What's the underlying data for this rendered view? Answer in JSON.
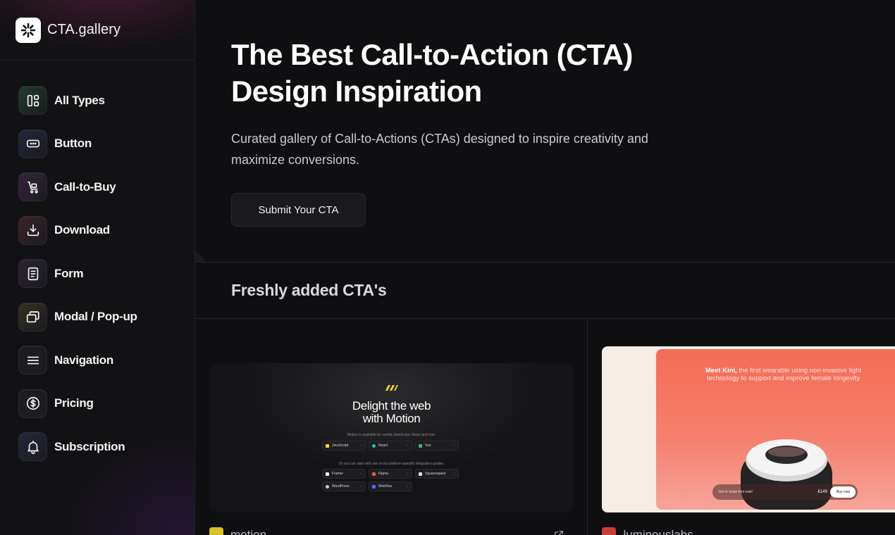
{
  "brand": {
    "name": "CTA.gallery",
    "logo_icon": "sparkle-icon"
  },
  "sidebar": {
    "items": [
      {
        "label": "All Types",
        "icon": "grid-layout-icon",
        "accent": "#2f4a3a"
      },
      {
        "label": "Button",
        "icon": "button-icon",
        "accent": "#262a3a"
      },
      {
        "label": "Call-to-Buy",
        "icon": "cart-icon",
        "accent": "#3a2a3a"
      },
      {
        "label": "Download",
        "icon": "download-icon",
        "accent": "#3a2a2e"
      },
      {
        "label": "Form",
        "icon": "form-icon",
        "accent": "#2a2630"
      },
      {
        "label": "Modal / Pop-up",
        "icon": "modal-icon",
        "accent": "#33302a"
      },
      {
        "label": "Navigation",
        "icon": "menu-icon",
        "accent": "#26262b"
      },
      {
        "label": "Pricing",
        "icon": "dollar-icon",
        "accent": "#26262b"
      },
      {
        "label": "Subscription",
        "icon": "bell-icon",
        "accent": "#262a36"
      }
    ]
  },
  "hero": {
    "title": "The Best Call-to-Action (CTA) Design Inspiration",
    "subtitle": "Curated gallery of Call-to-Actions (CTAs) designed to inspire creativity and maximize conversions.",
    "cta_label": "Submit Your CTA"
  },
  "section": {
    "title": "Freshly added CTA's"
  },
  "cards": [
    {
      "name": "motion",
      "preview": {
        "title": "Delight the web with Motion",
        "caption": "Motion is available for vanilla JavaScript, React and Vue.",
        "chips_row1": [
          "JavaScript",
          "React",
          "Vue"
        ],
        "caption2": "Or you can start with one of our platform-specific integration guides.",
        "chips_row2": [
          "Framer",
          "Figma",
          "Squarespace"
        ],
        "chips_row3": [
          "WordPress",
          "Webflow"
        ]
      }
    },
    {
      "name": "luminouslabs",
      "preview": {
        "headline_bold": "Meet Kini,",
        "headline_rest": " the first wearable using non-invasive light technology to support and improve female longevity",
        "bar_text": "Get to know Kini now!",
        "price": "€149",
        "buy_label": "Buy now"
      }
    }
  ]
}
